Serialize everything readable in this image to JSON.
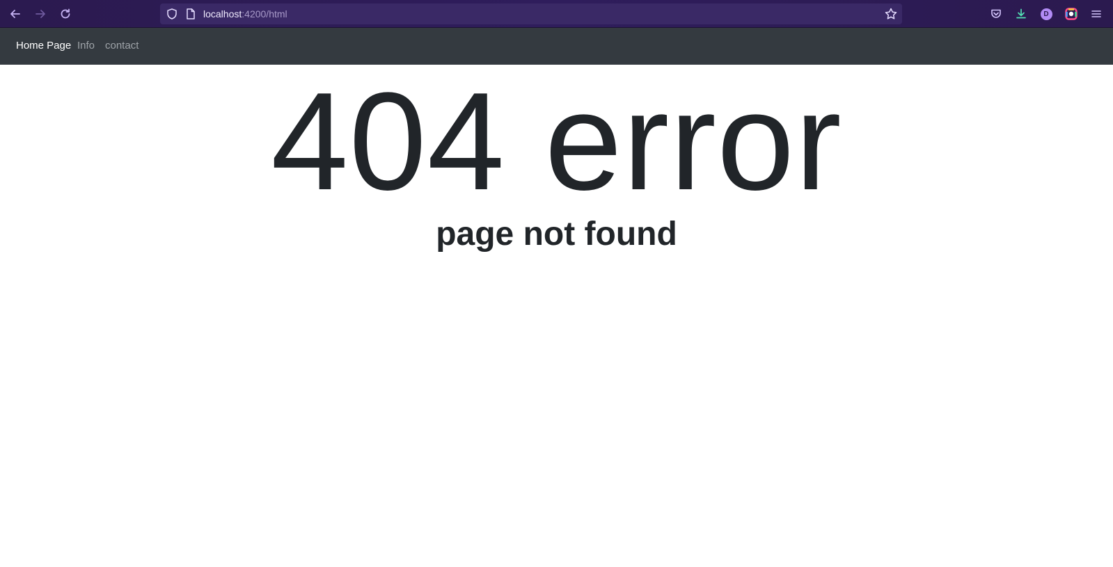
{
  "browser": {
    "url_host": "localhost",
    "url_path": ":4200/html",
    "colors": {
      "toolbar": "#2b1a4f",
      "urlbar": "#3a2966",
      "icon": "#c7b4f5"
    },
    "icons": {
      "back": "arrow-left-icon",
      "forward": "arrow-right-icon",
      "reload": "reload-icon",
      "shield": "shield-icon",
      "page": "page-icon",
      "bookmark": "star-icon",
      "pocket": "pocket-icon",
      "downloads": "download-icon",
      "extension": "colorful-ring-icon",
      "menu": "hamburger-menu-icon"
    },
    "avatar_letter": "D"
  },
  "navbar": {
    "items": [
      {
        "label": "Home Page",
        "active": true
      },
      {
        "label": "Info",
        "active": false
      },
      {
        "label": "contact",
        "active": false
      }
    ],
    "background": "#343a40"
  },
  "main": {
    "title": "404 error",
    "subtitle": "page not found",
    "text_color": "#212529"
  }
}
